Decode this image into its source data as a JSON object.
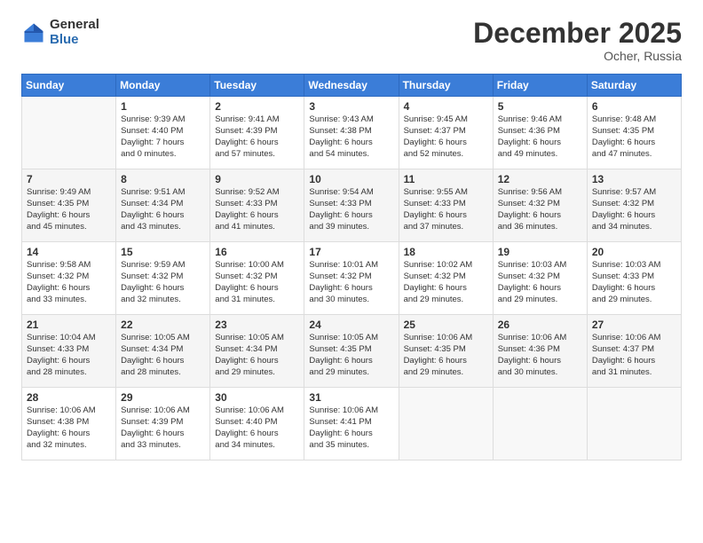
{
  "logo": {
    "general": "General",
    "blue": "Blue"
  },
  "title": "December 2025",
  "subtitle": "Ocher, Russia",
  "days_header": [
    "Sunday",
    "Monday",
    "Tuesday",
    "Wednesday",
    "Thursday",
    "Friday",
    "Saturday"
  ],
  "weeks": [
    [
      {
        "day": "",
        "info": ""
      },
      {
        "day": "1",
        "info": "Sunrise: 9:39 AM\nSunset: 4:40 PM\nDaylight: 7 hours\nand 0 minutes."
      },
      {
        "day": "2",
        "info": "Sunrise: 9:41 AM\nSunset: 4:39 PM\nDaylight: 6 hours\nand 57 minutes."
      },
      {
        "day": "3",
        "info": "Sunrise: 9:43 AM\nSunset: 4:38 PM\nDaylight: 6 hours\nand 54 minutes."
      },
      {
        "day": "4",
        "info": "Sunrise: 9:45 AM\nSunset: 4:37 PM\nDaylight: 6 hours\nand 52 minutes."
      },
      {
        "day": "5",
        "info": "Sunrise: 9:46 AM\nSunset: 4:36 PM\nDaylight: 6 hours\nand 49 minutes."
      },
      {
        "day": "6",
        "info": "Sunrise: 9:48 AM\nSunset: 4:35 PM\nDaylight: 6 hours\nand 47 minutes."
      }
    ],
    [
      {
        "day": "7",
        "info": "Sunrise: 9:49 AM\nSunset: 4:35 PM\nDaylight: 6 hours\nand 45 minutes."
      },
      {
        "day": "8",
        "info": "Sunrise: 9:51 AM\nSunset: 4:34 PM\nDaylight: 6 hours\nand 43 minutes."
      },
      {
        "day": "9",
        "info": "Sunrise: 9:52 AM\nSunset: 4:33 PM\nDaylight: 6 hours\nand 41 minutes."
      },
      {
        "day": "10",
        "info": "Sunrise: 9:54 AM\nSunset: 4:33 PM\nDaylight: 6 hours\nand 39 minutes."
      },
      {
        "day": "11",
        "info": "Sunrise: 9:55 AM\nSunset: 4:33 PM\nDaylight: 6 hours\nand 37 minutes."
      },
      {
        "day": "12",
        "info": "Sunrise: 9:56 AM\nSunset: 4:32 PM\nDaylight: 6 hours\nand 36 minutes."
      },
      {
        "day": "13",
        "info": "Sunrise: 9:57 AM\nSunset: 4:32 PM\nDaylight: 6 hours\nand 34 minutes."
      }
    ],
    [
      {
        "day": "14",
        "info": "Sunrise: 9:58 AM\nSunset: 4:32 PM\nDaylight: 6 hours\nand 33 minutes."
      },
      {
        "day": "15",
        "info": "Sunrise: 9:59 AM\nSunset: 4:32 PM\nDaylight: 6 hours\nand 32 minutes."
      },
      {
        "day": "16",
        "info": "Sunrise: 10:00 AM\nSunset: 4:32 PM\nDaylight: 6 hours\nand 31 minutes."
      },
      {
        "day": "17",
        "info": "Sunrise: 10:01 AM\nSunset: 4:32 PM\nDaylight: 6 hours\nand 30 minutes."
      },
      {
        "day": "18",
        "info": "Sunrise: 10:02 AM\nSunset: 4:32 PM\nDaylight: 6 hours\nand 29 minutes."
      },
      {
        "day": "19",
        "info": "Sunrise: 10:03 AM\nSunset: 4:32 PM\nDaylight: 6 hours\nand 29 minutes."
      },
      {
        "day": "20",
        "info": "Sunrise: 10:03 AM\nSunset: 4:33 PM\nDaylight: 6 hours\nand 29 minutes."
      }
    ],
    [
      {
        "day": "21",
        "info": "Sunrise: 10:04 AM\nSunset: 4:33 PM\nDaylight: 6 hours\nand 28 minutes."
      },
      {
        "day": "22",
        "info": "Sunrise: 10:05 AM\nSunset: 4:34 PM\nDaylight: 6 hours\nand 28 minutes."
      },
      {
        "day": "23",
        "info": "Sunrise: 10:05 AM\nSunset: 4:34 PM\nDaylight: 6 hours\nand 29 minutes."
      },
      {
        "day": "24",
        "info": "Sunrise: 10:05 AM\nSunset: 4:35 PM\nDaylight: 6 hours\nand 29 minutes."
      },
      {
        "day": "25",
        "info": "Sunrise: 10:06 AM\nSunset: 4:35 PM\nDaylight: 6 hours\nand 29 minutes."
      },
      {
        "day": "26",
        "info": "Sunrise: 10:06 AM\nSunset: 4:36 PM\nDaylight: 6 hours\nand 30 minutes."
      },
      {
        "day": "27",
        "info": "Sunrise: 10:06 AM\nSunset: 4:37 PM\nDaylight: 6 hours\nand 31 minutes."
      }
    ],
    [
      {
        "day": "28",
        "info": "Sunrise: 10:06 AM\nSunset: 4:38 PM\nDaylight: 6 hours\nand 32 minutes."
      },
      {
        "day": "29",
        "info": "Sunrise: 10:06 AM\nSunset: 4:39 PM\nDaylight: 6 hours\nand 33 minutes."
      },
      {
        "day": "30",
        "info": "Sunrise: 10:06 AM\nSunset: 4:40 PM\nDaylight: 6 hours\nand 34 minutes."
      },
      {
        "day": "31",
        "info": "Sunrise: 10:06 AM\nSunset: 4:41 PM\nDaylight: 6 hours\nand 35 minutes."
      },
      {
        "day": "",
        "info": ""
      },
      {
        "day": "",
        "info": ""
      },
      {
        "day": "",
        "info": ""
      }
    ]
  ],
  "shaded_rows": [
    1,
    3
  ]
}
